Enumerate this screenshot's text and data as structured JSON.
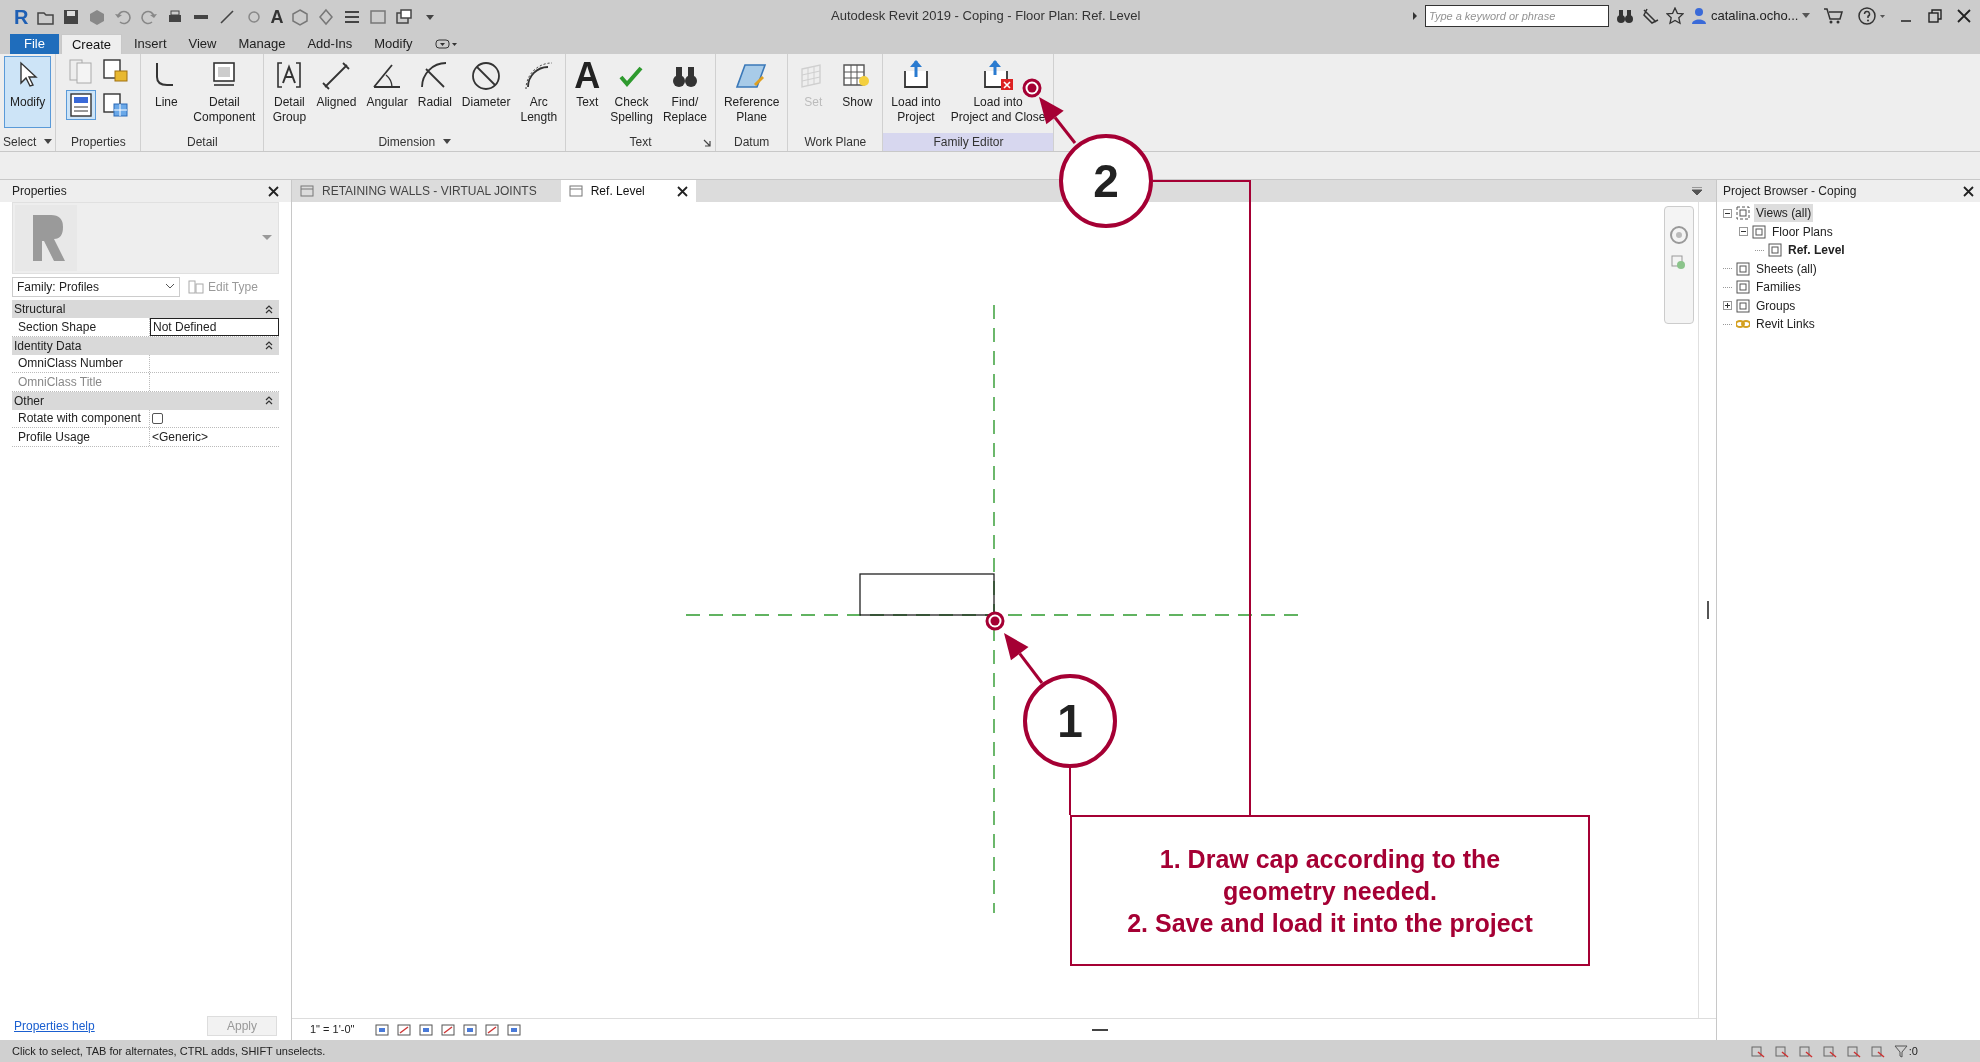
{
  "window": {
    "app_logo": "R",
    "quick_access_glyph": "A",
    "title": "Autodesk Revit 2019 - Coping - Floor Plan: Ref. Level",
    "search": {
      "placeholder": "Type a keyword or phrase"
    },
    "user": "catalina.ocho..."
  },
  "menu_tabs": [
    {
      "label": "File",
      "kind": "file",
      "selected": false
    },
    {
      "label": "Create",
      "kind": "tab",
      "selected": true
    },
    {
      "label": "Insert",
      "kind": "tab",
      "selected": false
    },
    {
      "label": "View",
      "kind": "tab",
      "selected": false
    },
    {
      "label": "Manage",
      "kind": "tab",
      "selected": false
    },
    {
      "label": "Add-Ins",
      "kind": "tab",
      "selected": false
    },
    {
      "label": "Modify",
      "kind": "tab",
      "selected": false
    }
  ],
  "ribbon": [
    {
      "title": "Select",
      "has_menu": true,
      "highlighted": false,
      "items": [
        {
          "label": "Modify",
          "selected": true,
          "disabled": false
        }
      ]
    },
    {
      "title": "Properties",
      "has_menu": false,
      "highlighted": false,
      "tools": [
        {
          "selected": false
        },
        {
          "selected": false
        },
        {
          "selected": true
        },
        {
          "selected": false
        }
      ]
    },
    {
      "title": "Detail",
      "has_menu": false,
      "highlighted": false,
      "items": [
        {
          "label": "Line",
          "selected": false,
          "disabled": false
        },
        {
          "label": "Detail\nComponent",
          "selected": false,
          "disabled": false
        }
      ]
    },
    {
      "title": "Dimension",
      "has_menu": true,
      "highlighted": false,
      "items": [
        {
          "label": "Detail\nGroup",
          "selected": false,
          "disabled": false
        },
        {
          "label": "Aligned",
          "selected": false,
          "disabled": false
        },
        {
          "label": "Angular",
          "selected": false,
          "disabled": false
        },
        {
          "label": "Radial",
          "selected": false,
          "disabled": false
        },
        {
          "label": "Diameter",
          "selected": false,
          "disabled": false
        },
        {
          "label": "Arc\nLength",
          "selected": false,
          "disabled": false
        }
      ]
    },
    {
      "title": "Text",
      "has_menu": false,
      "has_launcher": true,
      "highlighted": false,
      "items": [
        {
          "label": "Text",
          "glyph": "A",
          "selected": false,
          "disabled": false
        },
        {
          "label": "Check\nSpelling",
          "selected": false,
          "disabled": false
        },
        {
          "label": "Find/\nReplace",
          "selected": false,
          "disabled": false
        }
      ]
    },
    {
      "title": "Datum",
      "has_menu": false,
      "highlighted": false,
      "items": [
        {
          "label": "Reference\nPlane",
          "selected": false,
          "disabled": false
        }
      ]
    },
    {
      "title": "Work Plane",
      "has_menu": false,
      "highlighted": false,
      "items": [
        {
          "label": "Set",
          "selected": false,
          "disabled": true
        },
        {
          "label": "Show",
          "selected": false,
          "disabled": false
        }
      ]
    },
    {
      "title": "Family Editor",
      "has_menu": false,
      "highlighted": true,
      "items": [
        {
          "label": "Load into\nProject",
          "selected": false,
          "disabled": false
        },
        {
          "label": "Load into\nProject and Close",
          "selected": false,
          "disabled": false
        }
      ]
    }
  ],
  "properties": {
    "title": "Properties",
    "type_selector": "Family: Profiles",
    "edit_type": "Edit Type",
    "groups": [
      {
        "name": "Structural",
        "rows": [
          {
            "label": "Section Shape",
            "value": "Not Defined",
            "kind": "text",
            "editing": true,
            "disabled": false
          }
        ]
      },
      {
        "name": "Identity Data",
        "rows": [
          {
            "label": "OmniClass Number",
            "kind": "text",
            "disabled": false
          },
          {
            "label": "OmniClass Title",
            "kind": "text",
            "disabled": true
          }
        ]
      },
      {
        "name": "Other",
        "rows": [
          {
            "label": "Rotate with component",
            "kind": "checkbox",
            "checked": false,
            "disabled": false
          },
          {
            "label": "Profile Usage",
            "value": "<Generic>",
            "kind": "text",
            "disabled": false
          }
        ]
      }
    ],
    "help_link": "Properties help",
    "apply": "Apply"
  },
  "view_tabs": [
    {
      "label": "RETAINING WALLS - VIRTUAL JOINTS",
      "selected": false
    },
    {
      "label": "Ref. Level",
      "selected": true
    }
  ],
  "view_bar": {
    "scale": "1\" = 1'-0\""
  },
  "project_browser": {
    "title": "Project Browser - Coping",
    "tree": [
      {
        "label": "Views (all)",
        "expanded": true,
        "selected": true,
        "current": false,
        "children": [
          {
            "label": "Floor Plans",
            "expanded": true,
            "selected": false,
            "current": false,
            "children": [
              {
                "label": "Ref. Level",
                "selected": false,
                "current": true
              }
            ]
          }
        ]
      },
      {
        "label": "Sheets (all)",
        "selected": false,
        "current": false
      },
      {
        "label": "Families",
        "selected": false,
        "current": false
      },
      {
        "label": "Groups",
        "expanded": false,
        "selected": false,
        "current": false
      },
      {
        "label": "Revit Links",
        "selected": false,
        "current": false
      }
    ]
  },
  "status_bar": {
    "text": "Click to select, TAB for alternates, CTRL adds, SHIFT unselects.",
    "filter_count": ":0"
  },
  "annotation": {
    "callouts": [
      {
        "number": "1"
      },
      {
        "number": "2"
      }
    ],
    "note_lines": [
      "1. Draw cap according to the geometry needed.",
      "2. Save and load it into the project"
    ]
  }
}
